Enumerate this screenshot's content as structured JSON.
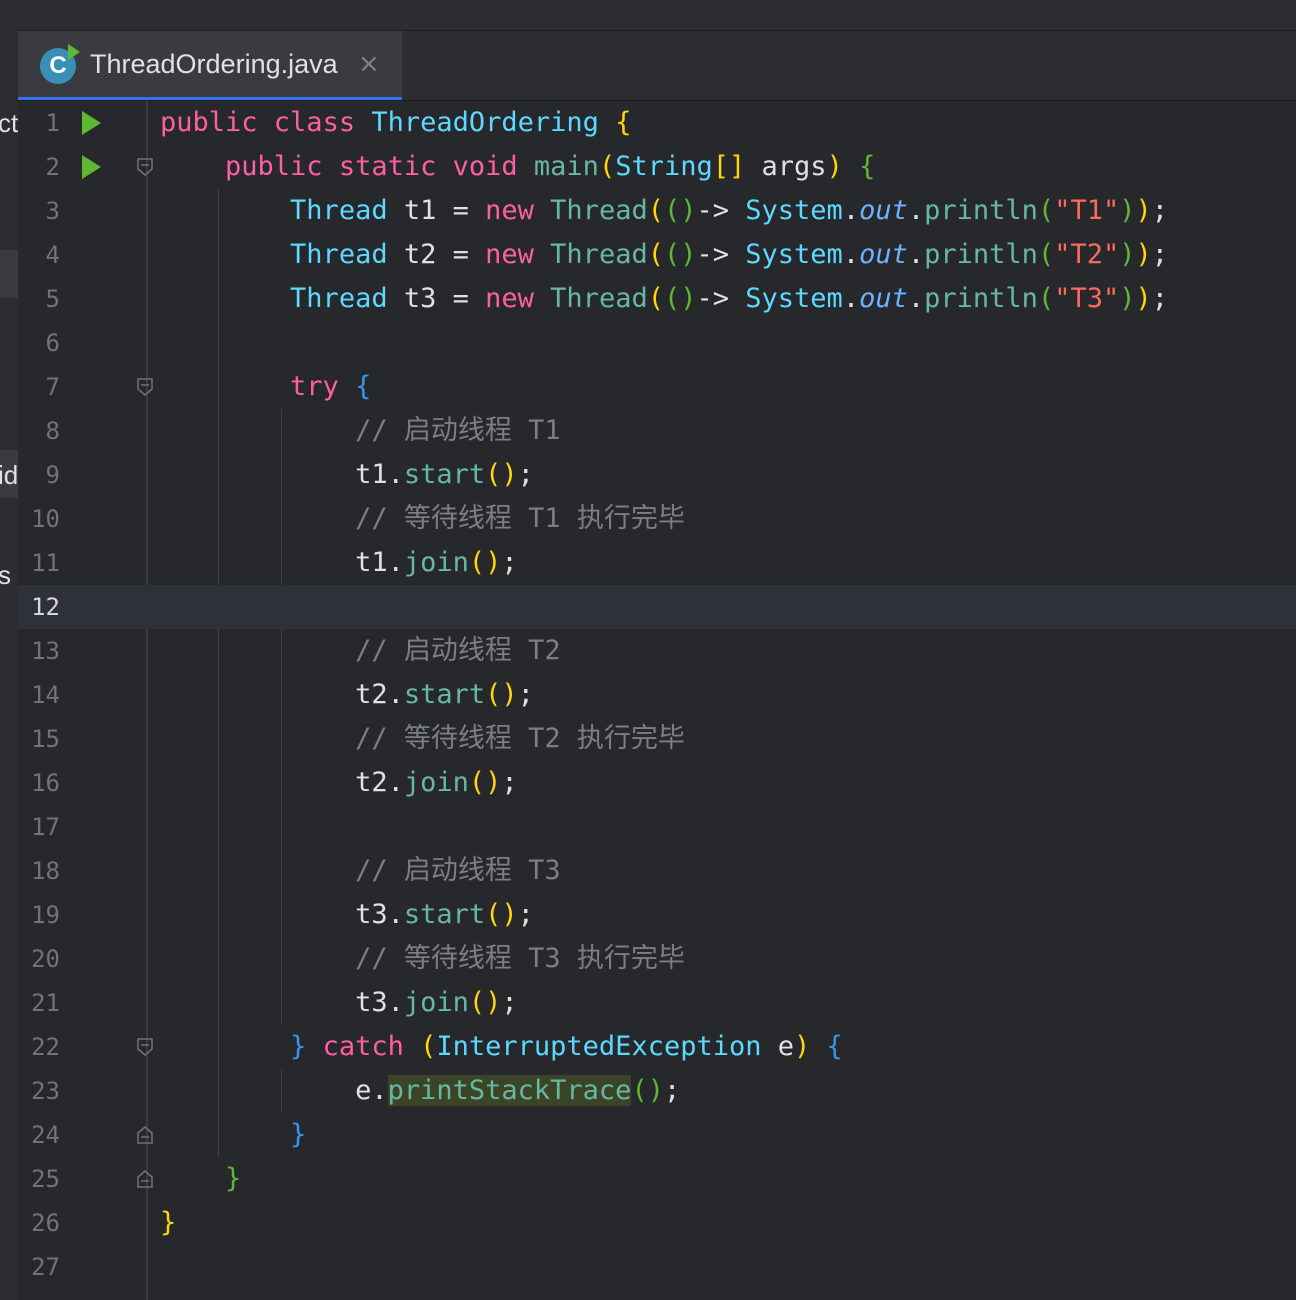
{
  "left_panel": {
    "fragments": [
      "ct]",
      "id",
      "s"
    ]
  },
  "tab": {
    "label": "ThreadOrdering.java",
    "icon_letter": "C",
    "close": "×"
  },
  "editor": {
    "current_line": 12,
    "lines": [
      [
        [
          "public ",
          "k"
        ],
        [
          "class ",
          "k"
        ],
        [
          "ThreadOrdering ",
          "t"
        ],
        [
          "{",
          "b1"
        ]
      ],
      [
        [
          "    ",
          ""
        ],
        [
          "public ",
          "k"
        ],
        [
          "static ",
          "k"
        ],
        [
          "void ",
          "k"
        ],
        [
          "main",
          "m"
        ],
        [
          "(",
          "b1"
        ],
        [
          "String",
          "t"
        ],
        [
          "[] ",
          "b1"
        ],
        [
          "args",
          "n"
        ],
        [
          ") ",
          "b1"
        ],
        [
          "{",
          "b2"
        ]
      ],
      [
        [
          "        ",
          ""
        ],
        [
          "Thread ",
          "t"
        ],
        [
          "t1 ",
          "n"
        ],
        [
          "= ",
          "p"
        ],
        [
          "new ",
          "k"
        ],
        [
          "Thread",
          "m"
        ],
        [
          "(",
          "b1"
        ],
        [
          "()",
          "b2"
        ],
        [
          "-> ",
          "p"
        ],
        [
          "System",
          "t"
        ],
        [
          ".",
          "p"
        ],
        [
          "out",
          "st"
        ],
        [
          ".",
          "p"
        ],
        [
          "println",
          "m"
        ],
        [
          "(",
          "b2"
        ],
        [
          "\"T1\"",
          "s"
        ],
        [
          ")",
          "b2"
        ],
        [
          ")",
          "b1"
        ],
        [
          ";",
          "p"
        ]
      ],
      [
        [
          "        ",
          ""
        ],
        [
          "Thread ",
          "t"
        ],
        [
          "t2 ",
          "n"
        ],
        [
          "= ",
          "p"
        ],
        [
          "new ",
          "k"
        ],
        [
          "Thread",
          "m"
        ],
        [
          "(",
          "b1"
        ],
        [
          "()",
          "b2"
        ],
        [
          "-> ",
          "p"
        ],
        [
          "System",
          "t"
        ],
        [
          ".",
          "p"
        ],
        [
          "out",
          "st"
        ],
        [
          ".",
          "p"
        ],
        [
          "println",
          "m"
        ],
        [
          "(",
          "b2"
        ],
        [
          "\"T2\"",
          "s"
        ],
        [
          ")",
          "b2"
        ],
        [
          ")",
          "b1"
        ],
        [
          ";",
          "p"
        ]
      ],
      [
        [
          "        ",
          ""
        ],
        [
          "Thread ",
          "t"
        ],
        [
          "t3 ",
          "n"
        ],
        [
          "= ",
          "p"
        ],
        [
          "new ",
          "k"
        ],
        [
          "Thread",
          "m"
        ],
        [
          "(",
          "b1"
        ],
        [
          "()",
          "b2"
        ],
        [
          "-> ",
          "p"
        ],
        [
          "System",
          "t"
        ],
        [
          ".",
          "p"
        ],
        [
          "out",
          "st"
        ],
        [
          ".",
          "p"
        ],
        [
          "println",
          "m"
        ],
        [
          "(",
          "b2"
        ],
        [
          "\"T3\"",
          "s"
        ],
        [
          ")",
          "b2"
        ],
        [
          ")",
          "b1"
        ],
        [
          ";",
          "p"
        ]
      ],
      [],
      [
        [
          "        ",
          ""
        ],
        [
          "try ",
          "k"
        ],
        [
          "{",
          "b3"
        ]
      ],
      [
        [
          "            ",
          ""
        ],
        [
          "// 启动线程 T1",
          "c"
        ]
      ],
      [
        [
          "            ",
          ""
        ],
        [
          "t1",
          "n"
        ],
        [
          ".",
          "p"
        ],
        [
          "start",
          "m"
        ],
        [
          "()",
          "b1"
        ],
        [
          ";",
          "p"
        ]
      ],
      [
        [
          "            ",
          ""
        ],
        [
          "// 等待线程 T1 执行完毕",
          "c"
        ]
      ],
      [
        [
          "            ",
          ""
        ],
        [
          "t1",
          "n"
        ],
        [
          ".",
          "p"
        ],
        [
          "join",
          "m"
        ],
        [
          "()",
          "b1"
        ],
        [
          ";",
          "p"
        ]
      ],
      [],
      [
        [
          "            ",
          ""
        ],
        [
          "// 启动线程 T2",
          "c"
        ]
      ],
      [
        [
          "            ",
          ""
        ],
        [
          "t2",
          "n"
        ],
        [
          ".",
          "p"
        ],
        [
          "start",
          "m"
        ],
        [
          "()",
          "b1"
        ],
        [
          ";",
          "p"
        ]
      ],
      [
        [
          "            ",
          ""
        ],
        [
          "// 等待线程 T2 执行完毕",
          "c"
        ]
      ],
      [
        [
          "            ",
          ""
        ],
        [
          "t2",
          "n"
        ],
        [
          ".",
          "p"
        ],
        [
          "join",
          "m"
        ],
        [
          "()",
          "b1"
        ],
        [
          ";",
          "p"
        ]
      ],
      [],
      [
        [
          "            ",
          ""
        ],
        [
          "// 启动线程 T3",
          "c"
        ]
      ],
      [
        [
          "            ",
          ""
        ],
        [
          "t3",
          "n"
        ],
        [
          ".",
          "p"
        ],
        [
          "start",
          "m"
        ],
        [
          "()",
          "b1"
        ],
        [
          ";",
          "p"
        ]
      ],
      [
        [
          "            ",
          ""
        ],
        [
          "// 等待线程 T3 执行完毕",
          "c"
        ]
      ],
      [
        [
          "            ",
          ""
        ],
        [
          "t3",
          "n"
        ],
        [
          ".",
          "p"
        ],
        [
          "join",
          "m"
        ],
        [
          "()",
          "b1"
        ],
        [
          ";",
          "p"
        ]
      ],
      [
        [
          "        ",
          ""
        ],
        [
          "} ",
          "b3"
        ],
        [
          "catch ",
          "k"
        ],
        [
          "(",
          "b1"
        ],
        [
          "InterruptedException ",
          "t"
        ],
        [
          "e",
          "n"
        ],
        [
          ") ",
          "b1"
        ],
        [
          "{",
          "b3"
        ]
      ],
      [
        [
          "            ",
          ""
        ],
        [
          "e",
          "n"
        ],
        [
          ".",
          "p"
        ],
        [
          "printStackTrace",
          "m warn"
        ],
        [
          "()",
          "b2"
        ],
        [
          ";",
          "p"
        ]
      ],
      [
        [
          "        ",
          ""
        ],
        [
          "}",
          "b3"
        ]
      ],
      [
        [
          "    ",
          ""
        ],
        [
          "}",
          "b2"
        ]
      ],
      [
        [
          "}",
          "b1"
        ]
      ],
      []
    ],
    "run_lines": [
      1,
      2
    ],
    "fold_open": [
      2,
      7,
      22
    ],
    "fold_close": [
      24,
      25
    ]
  },
  "colors": {
    "keyword": "#fc5fa3",
    "type": "#5dd8ff",
    "method": "#67b7a4",
    "string": "#fc6a5d",
    "comment": "#7a7e85",
    "accent": "#3574f0"
  }
}
